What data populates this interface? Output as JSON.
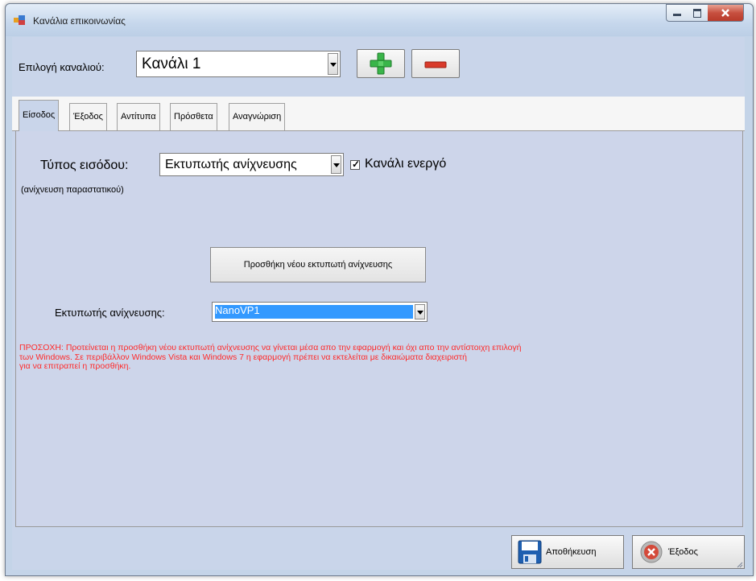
{
  "window": {
    "title": "Κανάλια επικοινωνίας"
  },
  "header": {
    "channel_label": "Επιλογή καναλιού:",
    "channel_value": "Κανάλι 1",
    "add_icon": "plus-icon",
    "remove_icon": "minus-icon"
  },
  "tabs": [
    {
      "label": "Είσοδος",
      "active": true
    },
    {
      "label": "Έξοδος",
      "active": false
    },
    {
      "label": "Αντίτυπα",
      "active": false
    },
    {
      "label": "Πρόσθετα",
      "active": false
    },
    {
      "label": "Αναγνώριση",
      "active": false
    }
  ],
  "input": {
    "type_label": "Τύπος εισόδου:",
    "type_value": "Εκτυπωτής ανίχνευσης",
    "active_checkbox_label": "Κανάλι ενεργό",
    "active_checked": true,
    "sub_label": "(ανίχνευση παραστατικού)",
    "add_printer_button": "Προσθήκη νέου εκτυπωτή ανίχνευσης",
    "printer_label": "Εκτυπωτής ανίχνευσης:",
    "printer_value": "NanoVP1",
    "warning_lines": [
      "ΠΡΟΣΟΧΗ: Προτείνεται η προσθήκη νέου εκτυπωτή ανίχνευσης να γίνεται μέσα απο την  εφαρμογή και όχι απο την αντίστοιχη επιλογή",
      "των Windows. Σε περιβάλλον Windows Vista και Windows 7 η εφαρμογή πρέπει να εκτελείται με δικαιώματα διαχειριστή",
      "για να επιτραπεί η προσθήκη."
    ]
  },
  "footer": {
    "save_label": "Αποθήκευση",
    "exit_label": "Έξοδος",
    "save_icon": "floppy-disk-icon",
    "exit_icon": "close-circle-icon"
  },
  "colors": {
    "warning": "#ff2a2a",
    "add_green": "#3ab54a",
    "remove_red": "#d93a2a",
    "selection_blue": "#3399ff"
  }
}
